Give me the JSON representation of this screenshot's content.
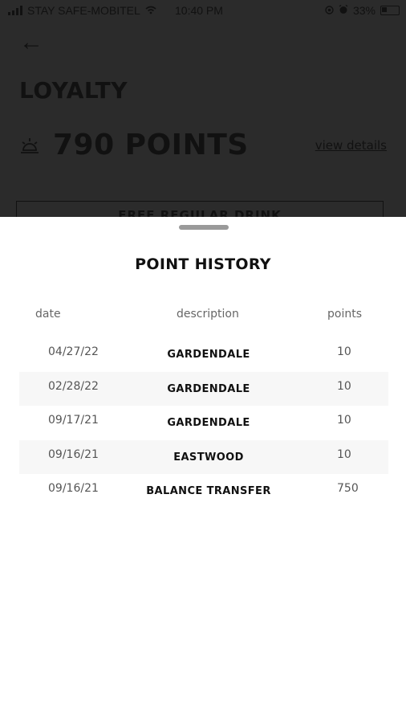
{
  "status_bar": {
    "carrier": "STAY SAFE-MOBITEL",
    "time": "10:40 PM",
    "battery": "33%"
  },
  "header": {
    "title": "LOYALTY",
    "points": "790 POINTS",
    "view_details": "view details",
    "reward_card": "FREE REGULAR DRINK"
  },
  "sheet": {
    "title": "POINT HISTORY",
    "columns": {
      "date": "date",
      "description": "description",
      "points": "points"
    },
    "rows": [
      {
        "date": "04/27/22",
        "description": "GARDENDALE",
        "points": "10"
      },
      {
        "date": "02/28/22",
        "description": "GARDENDALE",
        "points": "10"
      },
      {
        "date": "09/17/21",
        "description": "GARDENDALE",
        "points": "10"
      },
      {
        "date": "09/16/21",
        "description": "EASTWOOD",
        "points": "10"
      },
      {
        "date": "09/16/21",
        "description": "BALANCE TRANSFER",
        "points": "750"
      }
    ]
  },
  "icons": {
    "back": "arrow-left-icon",
    "points": "sun-icon",
    "wifi": "wifi-icon",
    "alarm": "alarm-icon"
  }
}
